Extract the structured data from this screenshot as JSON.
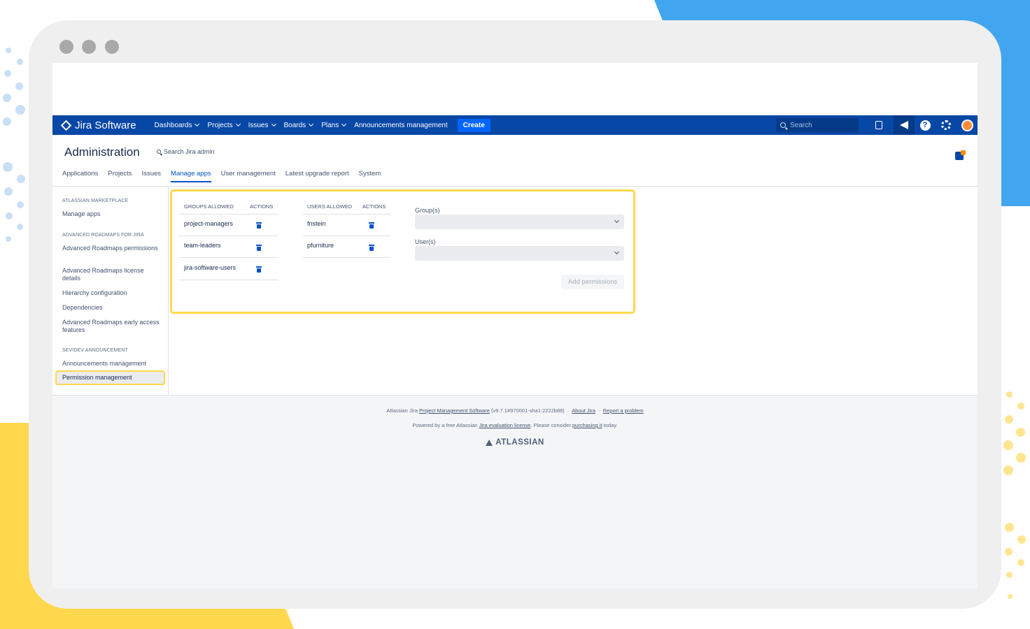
{
  "navbar": {
    "logo": "Jira Software",
    "items": [
      "Dashboards",
      "Projects",
      "Issues",
      "Boards",
      "Plans"
    ],
    "announcements": "Announcements management",
    "create": "Create",
    "search_placeholder": "Search"
  },
  "admin": {
    "title": "Administration",
    "search": "Search Jira admin",
    "tabs": [
      "Applications",
      "Projects",
      "Issues",
      "Manage apps",
      "User management",
      "Latest upgrade report",
      "System"
    ]
  },
  "sidebar": {
    "section1_title": "ATLASSIAN MARKETPLACE",
    "manage_apps": "Manage apps",
    "section2_title": "ADVANCED ROADMAPS FOR JIRA",
    "ar_permissions": "Advanced Roadmaps permissions",
    "ar_license": "Advanced Roadmaps license details",
    "hierarchy": "Hierarchy configuration",
    "dependencies": "Dependencies",
    "early_access": "Advanced Roadmaps early access features",
    "section3_title": "SEVIDEV ANNOUNCEMENT",
    "ann_management": "Announcements management",
    "permission_management": "Permission management"
  },
  "permissions": {
    "groups_header": "GROUPS ALLOWED",
    "actions_header": "ACTIONS",
    "users_header": "USERS ALLOWED",
    "groups": [
      "project-managers",
      "team-leaders",
      "jira-software-users"
    ],
    "users": [
      "fnstein",
      "pfurniture"
    ],
    "group_label": "Group(s)",
    "user_label": "User(s)",
    "add_button": "Add permissions"
  },
  "footer": {
    "prefix": "Atlassian Jira",
    "pm_link": "Project Management Software",
    "version": "(v9.7.1#970001-sha1:2222b88)",
    "sep": "·",
    "about": "About Jira",
    "report": "Report a problem",
    "powered": "Powered by a free Atlassian",
    "eval_link": "Jira evaluation license",
    "consider": ". Please consider",
    "purchasing": "purchasing it",
    "today": "today.",
    "brand": "ATLASSIAN"
  }
}
